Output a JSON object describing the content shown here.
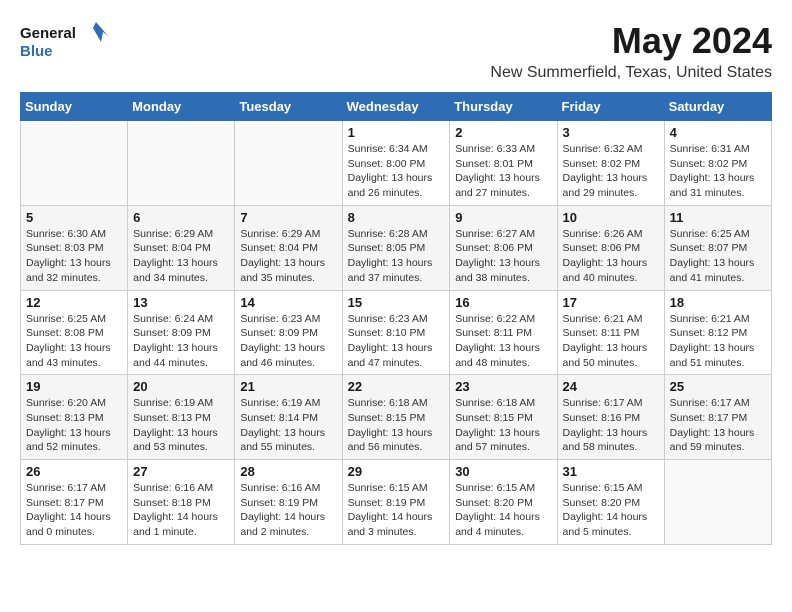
{
  "logo": {
    "line1": "General",
    "line2": "Blue"
  },
  "title": "May 2024",
  "location": "New Summerfield, Texas, United States",
  "weekdays": [
    "Sunday",
    "Monday",
    "Tuesday",
    "Wednesday",
    "Thursday",
    "Friday",
    "Saturday"
  ],
  "weeks": [
    [
      {
        "day": "",
        "info": ""
      },
      {
        "day": "",
        "info": ""
      },
      {
        "day": "",
        "info": ""
      },
      {
        "day": "1",
        "info": "Sunrise: 6:34 AM\nSunset: 8:00 PM\nDaylight: 13 hours and 26 minutes."
      },
      {
        "day": "2",
        "info": "Sunrise: 6:33 AM\nSunset: 8:01 PM\nDaylight: 13 hours and 27 minutes."
      },
      {
        "day": "3",
        "info": "Sunrise: 6:32 AM\nSunset: 8:02 PM\nDaylight: 13 hours and 29 minutes."
      },
      {
        "day": "4",
        "info": "Sunrise: 6:31 AM\nSunset: 8:02 PM\nDaylight: 13 hours and 31 minutes."
      }
    ],
    [
      {
        "day": "5",
        "info": "Sunrise: 6:30 AM\nSunset: 8:03 PM\nDaylight: 13 hours and 32 minutes."
      },
      {
        "day": "6",
        "info": "Sunrise: 6:29 AM\nSunset: 8:04 PM\nDaylight: 13 hours and 34 minutes."
      },
      {
        "day": "7",
        "info": "Sunrise: 6:29 AM\nSunset: 8:04 PM\nDaylight: 13 hours and 35 minutes."
      },
      {
        "day": "8",
        "info": "Sunrise: 6:28 AM\nSunset: 8:05 PM\nDaylight: 13 hours and 37 minutes."
      },
      {
        "day": "9",
        "info": "Sunrise: 6:27 AM\nSunset: 8:06 PM\nDaylight: 13 hours and 38 minutes."
      },
      {
        "day": "10",
        "info": "Sunrise: 6:26 AM\nSunset: 8:06 PM\nDaylight: 13 hours and 40 minutes."
      },
      {
        "day": "11",
        "info": "Sunrise: 6:25 AM\nSunset: 8:07 PM\nDaylight: 13 hours and 41 minutes."
      }
    ],
    [
      {
        "day": "12",
        "info": "Sunrise: 6:25 AM\nSunset: 8:08 PM\nDaylight: 13 hours and 43 minutes."
      },
      {
        "day": "13",
        "info": "Sunrise: 6:24 AM\nSunset: 8:09 PM\nDaylight: 13 hours and 44 minutes."
      },
      {
        "day": "14",
        "info": "Sunrise: 6:23 AM\nSunset: 8:09 PM\nDaylight: 13 hours and 46 minutes."
      },
      {
        "day": "15",
        "info": "Sunrise: 6:23 AM\nSunset: 8:10 PM\nDaylight: 13 hours and 47 minutes."
      },
      {
        "day": "16",
        "info": "Sunrise: 6:22 AM\nSunset: 8:11 PM\nDaylight: 13 hours and 48 minutes."
      },
      {
        "day": "17",
        "info": "Sunrise: 6:21 AM\nSunset: 8:11 PM\nDaylight: 13 hours and 50 minutes."
      },
      {
        "day": "18",
        "info": "Sunrise: 6:21 AM\nSunset: 8:12 PM\nDaylight: 13 hours and 51 minutes."
      }
    ],
    [
      {
        "day": "19",
        "info": "Sunrise: 6:20 AM\nSunset: 8:13 PM\nDaylight: 13 hours and 52 minutes."
      },
      {
        "day": "20",
        "info": "Sunrise: 6:19 AM\nSunset: 8:13 PM\nDaylight: 13 hours and 53 minutes."
      },
      {
        "day": "21",
        "info": "Sunrise: 6:19 AM\nSunset: 8:14 PM\nDaylight: 13 hours and 55 minutes."
      },
      {
        "day": "22",
        "info": "Sunrise: 6:18 AM\nSunset: 8:15 PM\nDaylight: 13 hours and 56 minutes."
      },
      {
        "day": "23",
        "info": "Sunrise: 6:18 AM\nSunset: 8:15 PM\nDaylight: 13 hours and 57 minutes."
      },
      {
        "day": "24",
        "info": "Sunrise: 6:17 AM\nSunset: 8:16 PM\nDaylight: 13 hours and 58 minutes."
      },
      {
        "day": "25",
        "info": "Sunrise: 6:17 AM\nSunset: 8:17 PM\nDaylight: 13 hours and 59 minutes."
      }
    ],
    [
      {
        "day": "26",
        "info": "Sunrise: 6:17 AM\nSunset: 8:17 PM\nDaylight: 14 hours and 0 minutes."
      },
      {
        "day": "27",
        "info": "Sunrise: 6:16 AM\nSunset: 8:18 PM\nDaylight: 14 hours and 1 minute."
      },
      {
        "day": "28",
        "info": "Sunrise: 6:16 AM\nSunset: 8:19 PM\nDaylight: 14 hours and 2 minutes."
      },
      {
        "day": "29",
        "info": "Sunrise: 6:15 AM\nSunset: 8:19 PM\nDaylight: 14 hours and 3 minutes."
      },
      {
        "day": "30",
        "info": "Sunrise: 6:15 AM\nSunset: 8:20 PM\nDaylight: 14 hours and 4 minutes."
      },
      {
        "day": "31",
        "info": "Sunrise: 6:15 AM\nSunset: 8:20 PM\nDaylight: 14 hours and 5 minutes."
      },
      {
        "day": "",
        "info": ""
      }
    ]
  ]
}
